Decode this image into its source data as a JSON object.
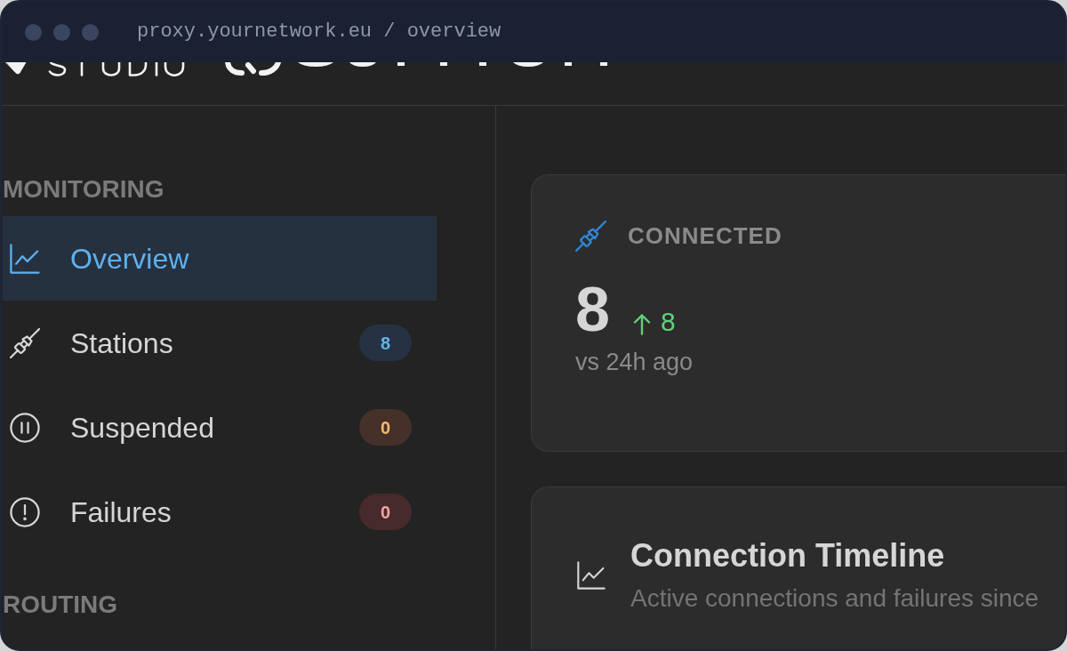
{
  "window": {
    "address": "proxy.yournetwork.eu / overview"
  },
  "sidebar": {
    "sections": [
      {
        "title": "MONITORING",
        "items": [
          {
            "label": "Overview",
            "selected": true
          },
          {
            "label": "Stations",
            "selected": false,
            "badge": {
              "text": "8",
              "kind": "info"
            }
          },
          {
            "label": "Suspended",
            "selected": false,
            "badge": {
              "text": "0",
              "kind": "warning"
            }
          },
          {
            "label": "Failures",
            "selected": false,
            "badge": {
              "text": "0",
              "kind": "danger"
            }
          }
        ]
      },
      {
        "title": "ROUTING"
      }
    ]
  },
  "stat_card": {
    "label": "CONNECTED",
    "value": "8",
    "change": {
      "positive": true,
      "text": "8"
    },
    "caption": "vs 24h ago"
  },
  "timeline_card": {
    "title": "Connection Timeline",
    "subtitle": "Active connections and failures since"
  }
}
